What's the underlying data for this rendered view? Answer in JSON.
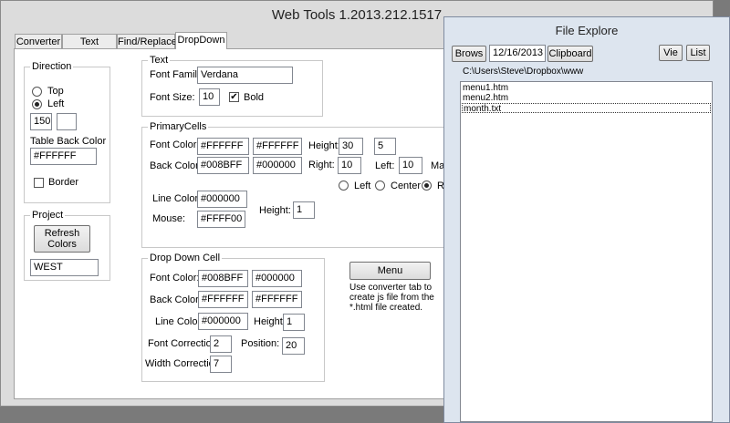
{
  "main": {
    "title": "Web Tools 1.2013.212.1517",
    "tabs": [
      "Converter",
      "Text Convert",
      "Find/Replace",
      "DropDown"
    ]
  },
  "direction": {
    "title": "Direction",
    "top_label": "Top",
    "left_label": "Left",
    "value1": "150",
    "value2": "",
    "table_back_color_label": "Table Back Color",
    "table_back_color": "#FFFFFF",
    "border_label": "Border"
  },
  "project": {
    "title": "Project",
    "refresh_label": "Refresh Colors",
    "name": "WEST"
  },
  "text": {
    "title": "Text",
    "font_family_label": "Font Family:",
    "font_family": "Verdana",
    "font_size_label": "Font Size:",
    "font_size": "10",
    "bold_label": "Bold"
  },
  "primary": {
    "title": "PrimaryCells",
    "font_color_label": "Font Color:",
    "font_color1": "#FFFFFF",
    "font_color2": "#FFFFFF",
    "height_label": "Height:",
    "height": "30",
    "height2": "5",
    "back_color_label": "Back Color:",
    "back_color1": "#008BFF",
    "back_color2": "#000000",
    "right_label": "Right:",
    "right": "10",
    "left_label": "Left:",
    "left": "10",
    "margin_label": "Ma",
    "align_left": "Left",
    "align_center": "Center",
    "align_right": "Ri",
    "line_color_label": "Line Color:",
    "line_color": "#000000",
    "mouse_label": "Mouse:",
    "mouse": "#FFFF00",
    "height3_label": "Height:",
    "height3": "1"
  },
  "dropdown": {
    "title": "Drop Down Cell",
    "font_color_label": "Font Color:",
    "font_color1": "#008BFF",
    "font_color2": "#000000",
    "back_color_label": "Back Color:",
    "back_color1": "#FFFFFF",
    "back_color2": "#FFFFFF",
    "line_color_label": "Line Color:",
    "line_color": "#000000",
    "height_label": "Height:",
    "height": "1",
    "font_correction_label": "Font Correction:",
    "font_correction": "2",
    "position_label": "Position:",
    "position": "20",
    "width_correction_label": "Width Correction:",
    "width_correction": "7"
  },
  "menu": {
    "button_label": "Menu",
    "note_line1": "Use converter tab to",
    "note_line2": "create js file from the",
    "note_line3": "*.html file created."
  },
  "file_explorer": {
    "title": "File Explore",
    "browse_label": "Brows",
    "date": "12/16/2013",
    "clipboard_label": "Clipboard",
    "view_label": "Vie",
    "list_label": "List",
    "path": "C:\\Users\\Steve\\Dropbox\\www",
    "files": [
      "menu1.htm",
      "menu2.htm",
      "month.txt"
    ]
  }
}
